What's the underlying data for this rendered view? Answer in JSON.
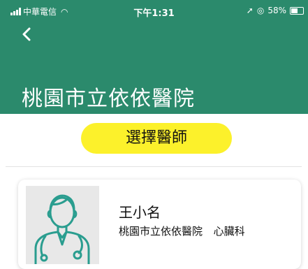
{
  "status_bar": {
    "carrier": "中華電信",
    "time": "下午1:31",
    "battery": "58%"
  },
  "header": {
    "title": "桃園市立依依醫院"
  },
  "select_doctor_button": {
    "label": "選擇醫師"
  },
  "doctor": {
    "name": "王小名",
    "hospital": "桃園市立依依醫院",
    "department": "心臟科"
  },
  "colors": {
    "header_bg": "#2b8a6c",
    "button_bg": "#fcf12b",
    "avatar_line": "#2a9d8f",
    "avatar_bg": "#e8e8e8"
  },
  "icons": {
    "back": "chevron-left-icon",
    "avatar": "doctor-stethoscope-icon"
  }
}
